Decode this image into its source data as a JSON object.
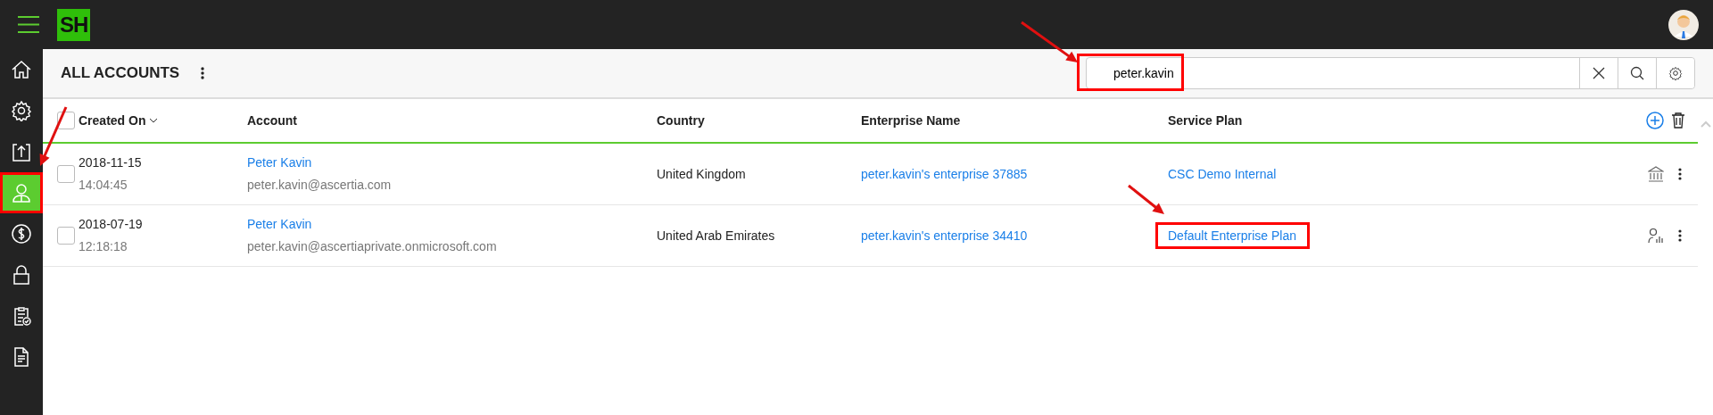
{
  "app": {
    "logo": "SH"
  },
  "sidebar": {
    "items": [
      {
        "kind": "home",
        "selected": false,
        "highlighted": false
      },
      {
        "kind": "settings",
        "selected": false,
        "highlighted": false
      },
      {
        "kind": "upload",
        "selected": false,
        "highlighted": false
      },
      {
        "kind": "person",
        "selected": true,
        "highlighted": true
      },
      {
        "kind": "dollar",
        "selected": false,
        "highlighted": false
      },
      {
        "kind": "lock",
        "selected": false,
        "highlighted": false
      },
      {
        "kind": "clipboard",
        "selected": false,
        "highlighted": false
      },
      {
        "kind": "document",
        "selected": false,
        "highlighted": false
      }
    ]
  },
  "page": {
    "title": "ALL ACCOUNTS"
  },
  "search": {
    "value": "peter.kavin",
    "highlighted": true
  },
  "table": {
    "select_all_checked": false,
    "columns": [
      {
        "label": "Created On",
        "sorted": true
      },
      {
        "label": "Account",
        "sorted": false
      },
      {
        "label": "Country",
        "sorted": false
      },
      {
        "label": "Enterprise Name",
        "sorted": false
      },
      {
        "label": "Service Plan",
        "sorted": false
      }
    ],
    "rows": [
      {
        "kind": "institution",
        "checked": false,
        "created_date": "2018-11-15",
        "created_time": "14:04:45",
        "account_name": "Peter Kavin",
        "account_email": "peter.kavin@ascertia.com",
        "country": "United Kingdom",
        "enterprise": "peter.kavin's enterprise 37885",
        "service_plan": "CSC Demo Internal",
        "service_plan_highlighted": false
      },
      {
        "kind": "person-chart",
        "checked": false,
        "created_date": "2018-07-19",
        "created_time": "12:18:18",
        "account_name": "Peter Kavin",
        "account_email": "peter.kavin@ascertiaprivate.onmicrosoft.com",
        "country": "United Arab Emirates",
        "enterprise": "peter.kavin's enterprise 34410",
        "service_plan": "Default Enterprise Plan",
        "service_plan_highlighted": true
      }
    ]
  }
}
